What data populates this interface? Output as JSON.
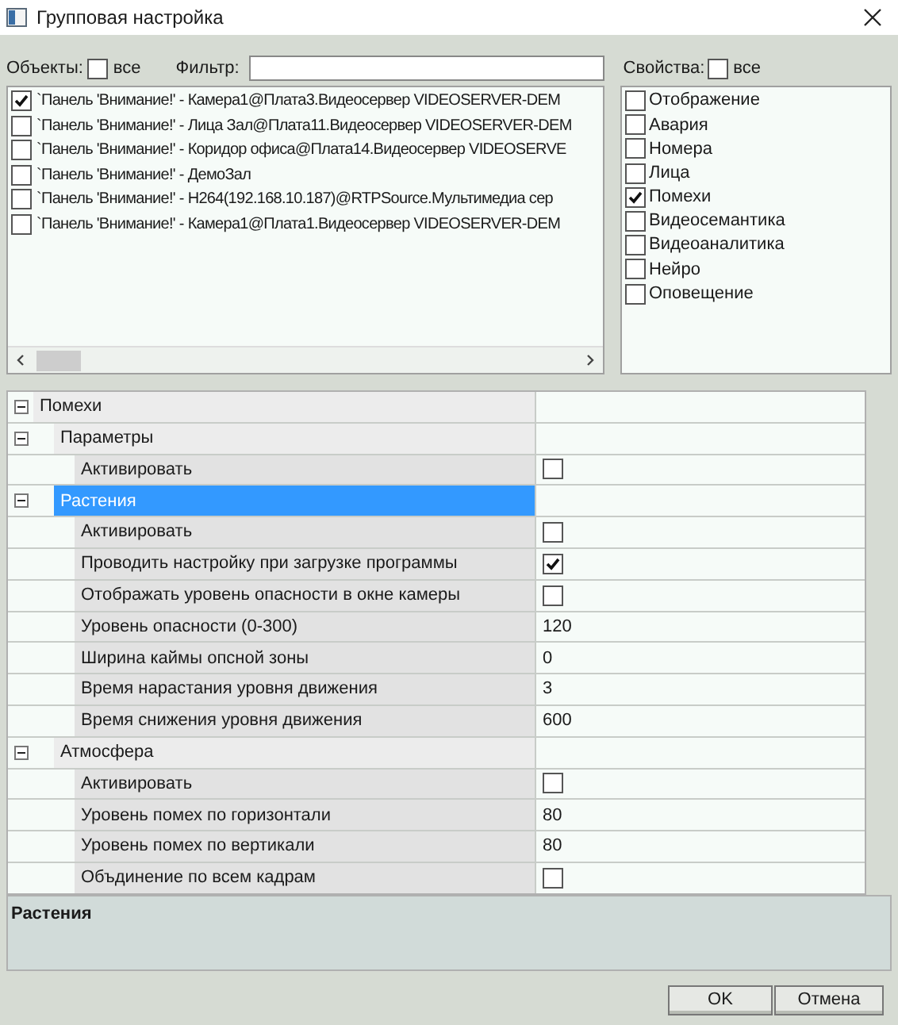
{
  "window": {
    "title": "Групповая настройка"
  },
  "objects": {
    "label": "Объекты:",
    "all_label": "все",
    "all_checked": false,
    "filter_label": "Фильтр:",
    "items": [
      {
        "text": "`Панель 'Внимание!' - Камера1@Плата3.Видеосервер VIDEOSERVER-DEM",
        "checked": true
      },
      {
        "text": "`Панель 'Внимание!' - Лица Зал@Плата11.Видеосервер VIDEOSERVER-DEM",
        "checked": false
      },
      {
        "text": "`Панель 'Внимание!' - Коридор офиса@Плата14.Видеосервер VIDEOSERVE",
        "checked": false
      },
      {
        "text": "`Панель 'Внимание!' - ДемоЗал",
        "checked": false
      },
      {
        "text": "`Панель 'Внимание!' - H264(192.168.10.187)@RTPSource.Мультимедиа сер",
        "checked": false
      },
      {
        "text": "`Панель 'Внимание!' - Камера1@Плата1.Видеосервер VIDEOSERVER-DEM",
        "checked": false
      }
    ]
  },
  "properties": {
    "label": "Свойства:",
    "all_label": "все",
    "all_checked": false,
    "items": [
      {
        "text": "Отображение",
        "checked": false
      },
      {
        "text": "Авария",
        "checked": false
      },
      {
        "text": "Номера",
        "checked": false
      },
      {
        "text": "Лица",
        "checked": false
      },
      {
        "text": "Помехи",
        "checked": true
      },
      {
        "text": "Видеосемантика",
        "checked": false
      },
      {
        "text": "Видеоаналитика",
        "checked": false
      },
      {
        "text": "Нейро",
        "checked": false
      },
      {
        "text": "Оповещение",
        "checked": false
      }
    ]
  },
  "grid": {
    "categories": [
      {
        "label": "Помехи",
        "expanded": true,
        "selected": false,
        "children": [
          {
            "label": "Параметры",
            "expanded": true,
            "selected": false,
            "children": [
              {
                "label": "Активировать",
                "kind": "checkbox",
                "checked": false
              }
            ]
          },
          {
            "label": "Растения",
            "expanded": true,
            "selected": true,
            "children": [
              {
                "label": "Активировать",
                "kind": "checkbox",
                "checked": false
              },
              {
                "label": "Проводить настройку при загрузке программы",
                "kind": "checkbox",
                "checked": true
              },
              {
                "label": "Отображать уровень опасности в окне камеры",
                "kind": "checkbox",
                "checked": false
              },
              {
                "label": "Уровень опасности (0-300)",
                "kind": "text",
                "value": "120"
              },
              {
                "label": "Ширина каймы опсной зоны",
                "kind": "text",
                "value": "0"
              },
              {
                "label": "Время нарастания уровня движения",
                "kind": "text",
                "value": "3"
              },
              {
                "label": "Время снижения уровня движения",
                "kind": "text",
                "value": "600"
              }
            ]
          },
          {
            "label": "Атмосфера",
            "expanded": true,
            "selected": false,
            "children": [
              {
                "label": "Активировать",
                "kind": "checkbox",
                "checked": false
              },
              {
                "label": "Уровень помех по горизонтали",
                "kind": "text",
                "value": "80"
              },
              {
                "label": "Уровень помех по вертикали",
                "kind": "text",
                "value": "80"
              },
              {
                "label": "Объдинение по всем кадрам",
                "kind": "checkbox",
                "checked": false
              }
            ]
          }
        ]
      }
    ]
  },
  "description": {
    "title": "Растения"
  },
  "buttons": [
    {
      "label": "OK"
    },
    {
      "label": "Отмена"
    }
  ]
}
